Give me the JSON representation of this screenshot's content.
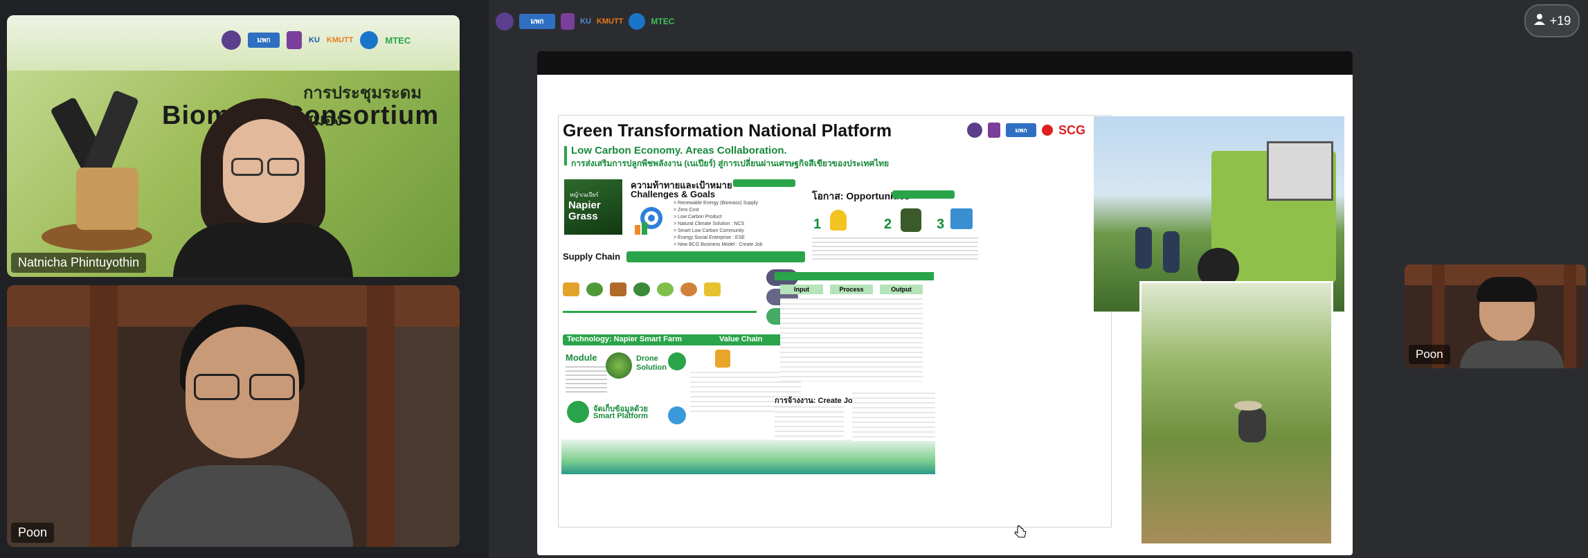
{
  "tiles": {
    "tile1": {
      "participant_name": "Natnicha Phintuyothin",
      "banner_thai": "การประชุมระดมสมอง",
      "banner_en": "Biomass Consortium"
    },
    "tile2": {
      "participant_name": "Poon"
    },
    "thumb": {
      "participant_name": "Poon"
    }
  },
  "logos": {
    "mwg": "มพก",
    "ku": "KU",
    "kmutt": "KMUTT",
    "mtec": "MTEC"
  },
  "participants": {
    "count": "+19"
  },
  "poster": {
    "title": "Green Transformation National Platform",
    "subtitle_en": "Low Carbon Economy. Areas Collaboration.",
    "subtitle_th": "การส่งเสริมการปลูกพืชพลังงาน (เนเปียร์) สู่การเปลี่ยนผ่านเศรษฐกิจสีเขียวของประเทศไทย",
    "scg": "SCG",
    "challenges_th": "ความท้าทายและเป้าหมาย",
    "challenges_en": "Challenges & Goals",
    "challenges_list": [
      "> Renewable Energy (Biomass) Supply",
      "> Zero Cost",
      "> Low Carbon Product",
      "> Natural Climate Solution : NCS",
      "> Smart Low Carbon Community",
      "> Energy Social Enterprise : ESE",
      "> New BCG Business Model : Create Job"
    ],
    "napier_th": "หญ้าเนเปียร์",
    "napier_en": "Napier Grass",
    "opportunities": "โอกาส: Opportunities",
    "opp_nums": [
      "1",
      "2",
      "3"
    ],
    "supply_chain": "Supply Chain",
    "technology": "Technology: Napier Smart Farm",
    "value_chain": "Value Chain",
    "module": "Module",
    "drone": "Drone Solution",
    "smart_platform_th": "จัดเก็บข้อมูลด้วย",
    "smart_platform_en": "Smart Platform",
    "io_headers": [
      "Input",
      "Process",
      "Output"
    ],
    "create_job": "การจ้างงาน: Create Job"
  }
}
